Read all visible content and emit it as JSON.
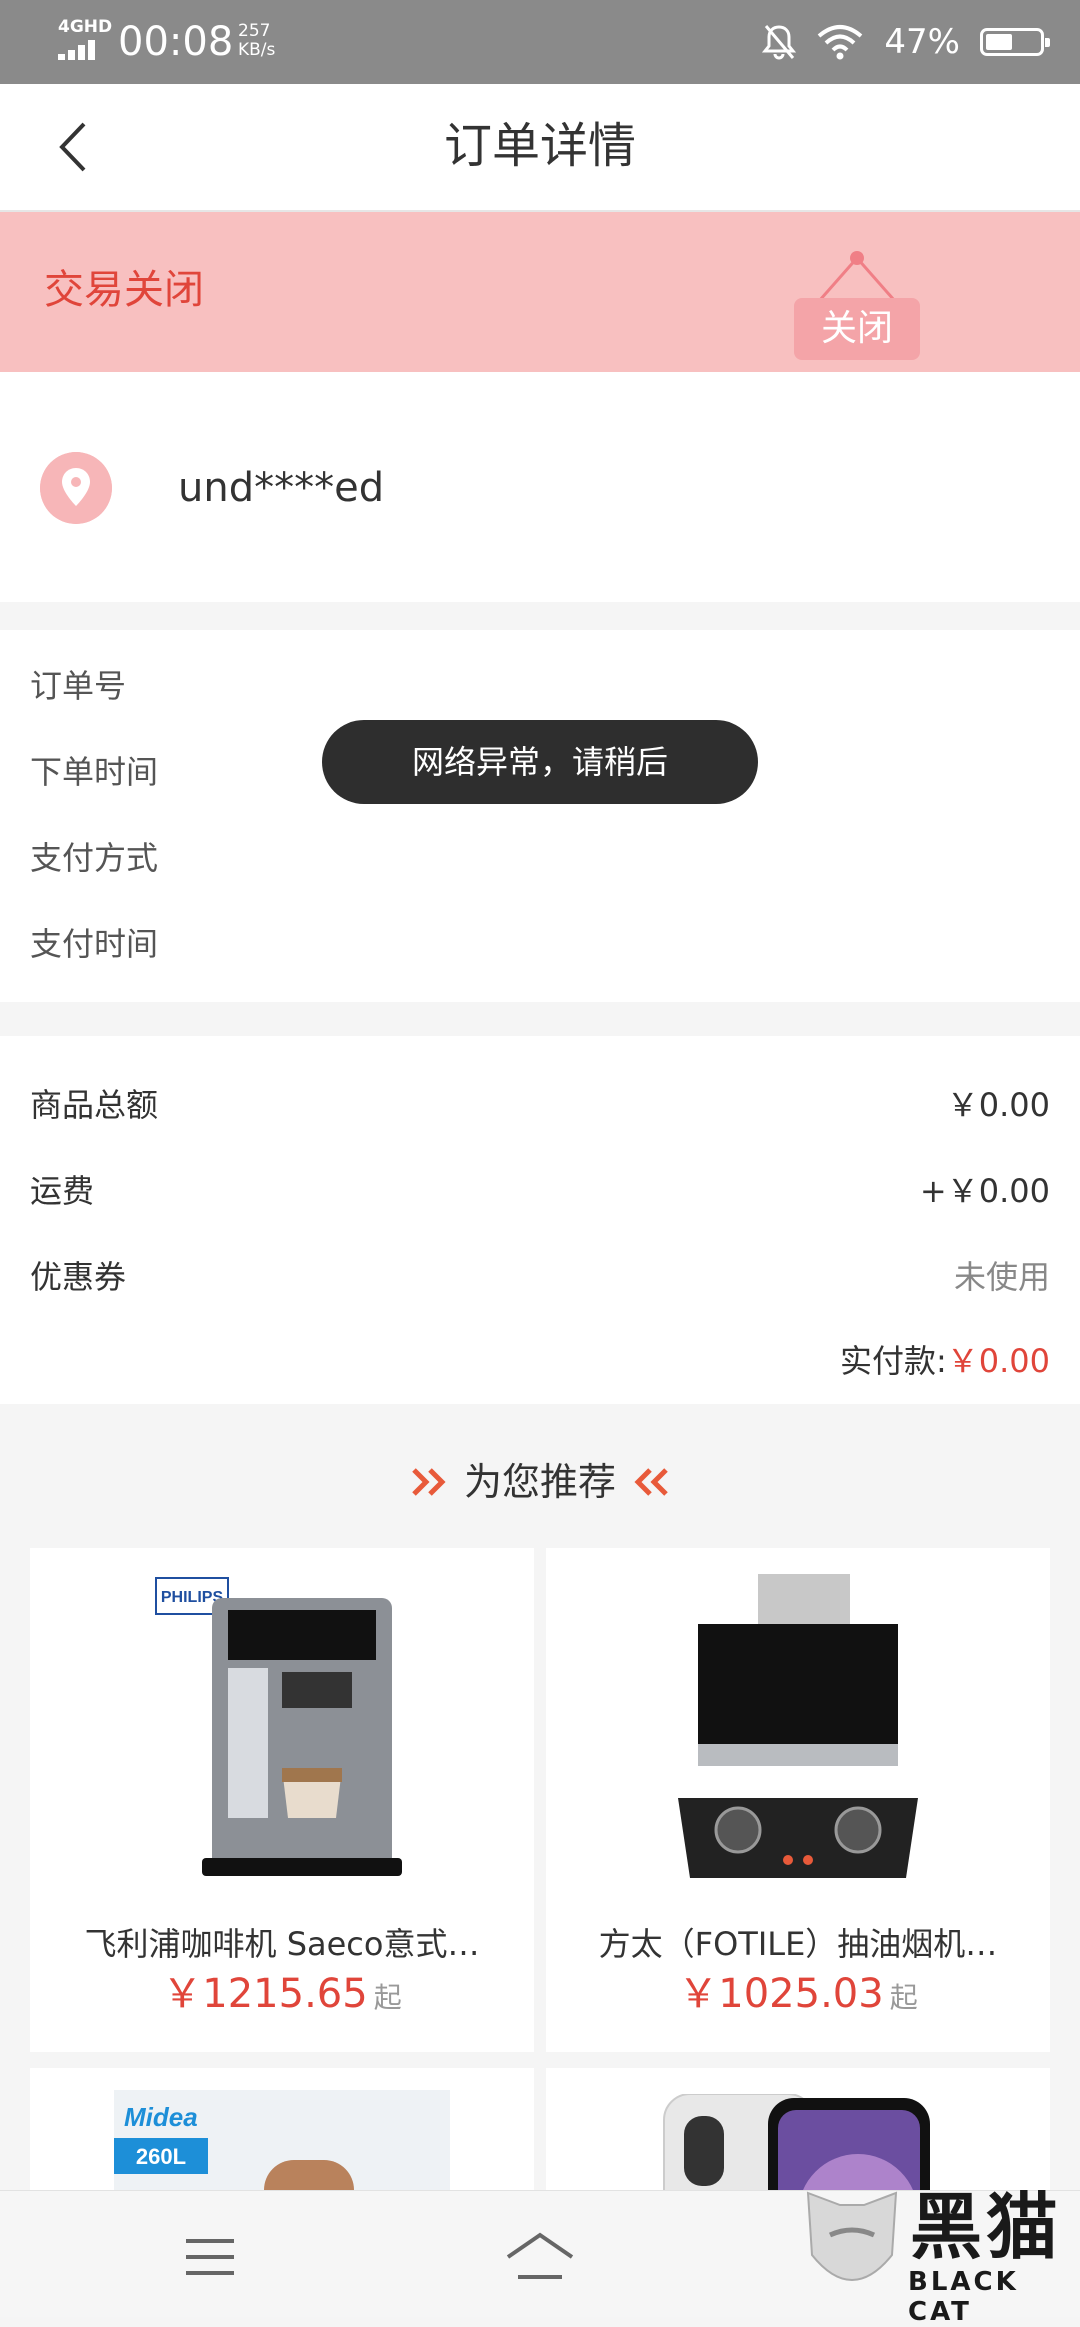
{
  "status_bar": {
    "network": "4GHD",
    "time": "00:08",
    "speed_value": "257",
    "speed_unit": "KB/s",
    "battery": "47%"
  },
  "header": {
    "title": "订单详情",
    "back_icon": "chevron-left-icon"
  },
  "banner": {
    "status_text": "交易关闭",
    "tag": "关闭",
    "color": "#f8c0c0",
    "accent": "#e0453a"
  },
  "address": {
    "icon": "location-pin-icon",
    "text": "und****ed"
  },
  "order_info": {
    "order_no_label": "订单号",
    "order_time_label": "下单时间",
    "pay_method_label": "支付方式",
    "pay_time_label": "支付时间"
  },
  "toast": {
    "text": "网络异常，请稍后"
  },
  "amounts": {
    "goods_total_label": "商品总额",
    "goods_total_value": "￥0.00",
    "shipping_label": "运费",
    "shipping_value": "+￥0.00",
    "coupon_label": "优惠券",
    "coupon_value": "未使用",
    "paid_label": "实付款:",
    "paid_value": "￥0.00"
  },
  "recommend": {
    "title": "为您推荐",
    "products": [
      {
        "name": "飞利浦咖啡机 Saeco意式…",
        "price": "￥1215.65",
        "suffix": "起",
        "image": "coffee-machine-image",
        "brand": "PHILIPS"
      },
      {
        "name": "方太（FOTILE）抽油烟机…",
        "price": "￥1025.03",
        "suffix": "起",
        "image": "range-hood-image"
      },
      {
        "name": "",
        "price": "",
        "suffix": "",
        "image": "water-heater-image",
        "brand": "Midea",
        "badge": "260L"
      },
      {
        "name": "",
        "price": "",
        "suffix": "",
        "image": "smartphone-image"
      }
    ]
  },
  "nav": {
    "menu_icon": "menu-icon",
    "home_icon": "home-icon"
  },
  "watermark": {
    "cn": "黑猫",
    "en": "BLACK CAT"
  }
}
